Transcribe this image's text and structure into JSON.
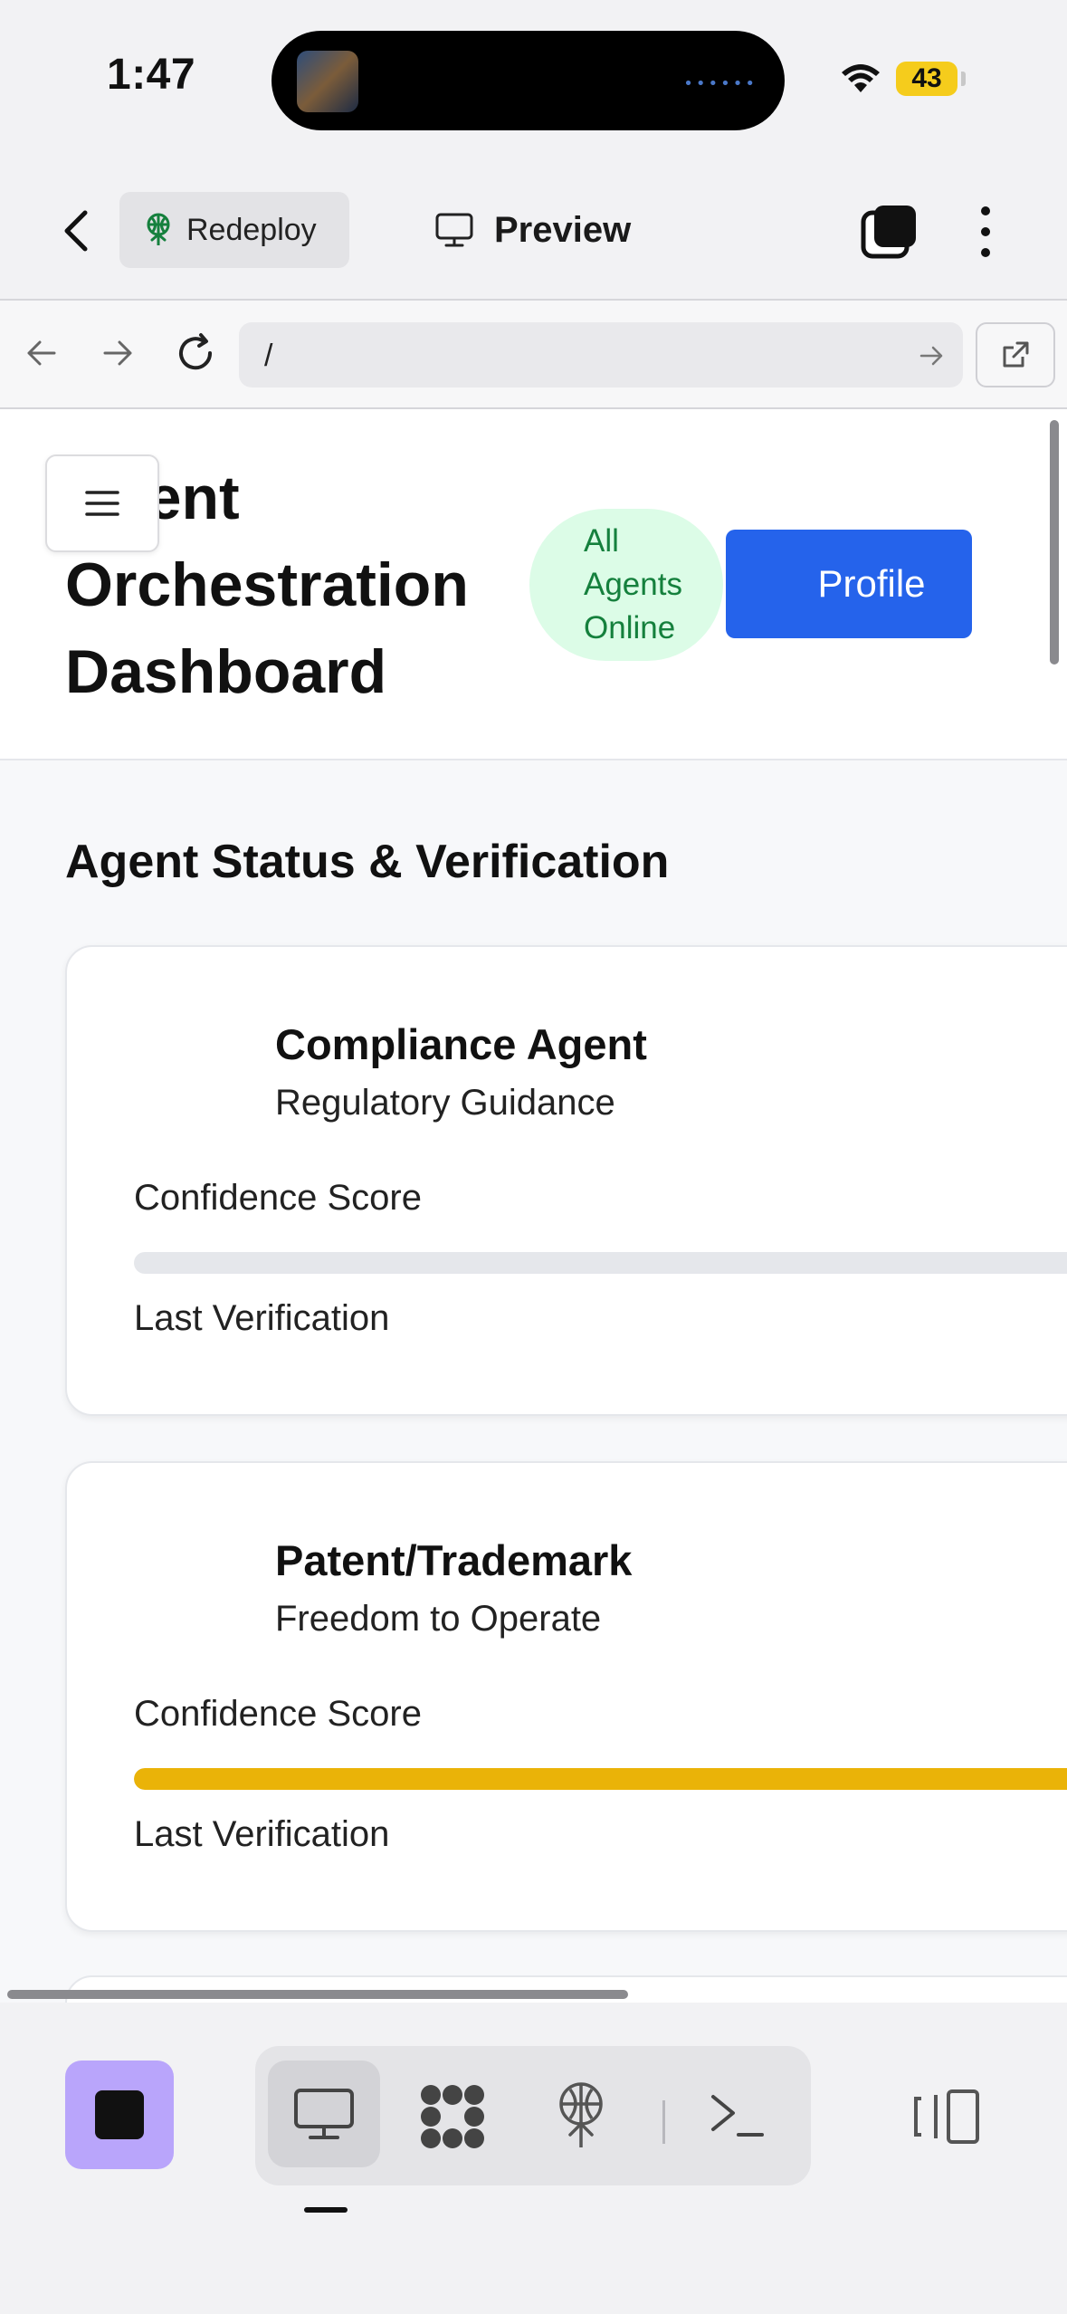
{
  "status_bar": {
    "time": "1:47",
    "battery": "43",
    "battery_color": "#f5cc1c"
  },
  "toolbar": {
    "back_icon": "chevron-left-icon",
    "redeploy_label": "Redeploy",
    "preview_label": "Preview",
    "tabs_icon": "tabs-icon",
    "more_icon": "more-vertical-icon"
  },
  "browser": {
    "url": "/",
    "back_icon": "arrow-left-icon",
    "forward_icon": "arrow-right-icon",
    "reload_icon": "reload-icon",
    "external_icon": "open-external-icon"
  },
  "page": {
    "title": "Agent Orchestration Dashboard",
    "status_pill": [
      "All",
      "Agents",
      "Online"
    ],
    "profile_label": "Profile",
    "section_title": "Agent Status & Verification",
    "accent_color": "#2563eb",
    "cards": [
      {
        "name": "Compliance Agent",
        "role": "Regulatory Guidance",
        "confidence_label": "Confidence Score",
        "confidence_fill": 0,
        "confidence_color": "#e5e7eb",
        "verification_label": "Last Verification"
      },
      {
        "name": "Patent/Trademark",
        "role": "Freedom to Operate",
        "confidence_label": "Confidence Score",
        "confidence_fill": 1,
        "confidence_color": "#eab308",
        "verification_label": "Last Verification"
      }
    ]
  },
  "bottom_bar": {
    "stop_color": "#b9a5fb",
    "tools": [
      "desktop-icon",
      "apps-icon",
      "deploy-icon",
      "terminal-icon"
    ],
    "panel_icon": "panel-toggle-icon"
  }
}
